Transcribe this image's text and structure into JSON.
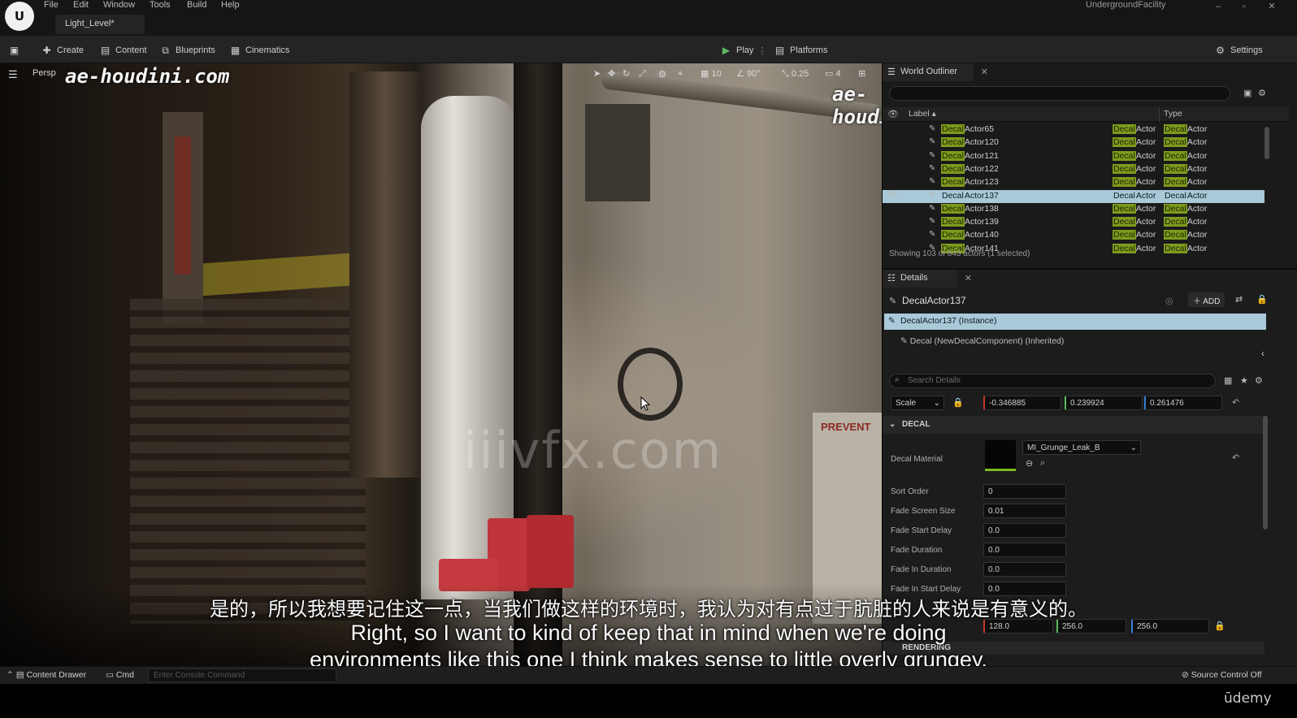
{
  "titlebar": {
    "logo": "U",
    "menus": [
      "File",
      "Edit",
      "Window",
      "Tools",
      "Build",
      "Help"
    ],
    "level_tab": "Light_Level*",
    "project": "UndergroundFacility",
    "win_min": "–",
    "win_max": "▫",
    "win_close": "✕"
  },
  "toolbar": {
    "create": "Create",
    "content": "Content",
    "blueprints": "Blueprints",
    "cinematics": "Cinematics",
    "play": "Play",
    "platforms": "Platforms",
    "settings": "Settings"
  },
  "viewport": {
    "perspective": "Persp",
    "grid": "10",
    "angle": "90°",
    "scale": "0.25",
    "camera": "4",
    "watermark_left": "ae-houdini.com",
    "watermark_right": "ae-houdini.com",
    "center_watermark": "iiivfx.com",
    "sign_text": "PREVENT"
  },
  "subtitles": {
    "cn": "是的，所以我想要记住这一点，当我们做这样的环境时，我认为对有点过于肮脏的人来说是有意义的。",
    "en1": "Right, so I want to kind of keep that in mind when we're doing",
    "en2": "environments like this one I think makes sense to little overly grungey."
  },
  "outliner": {
    "tab": "World Outliner",
    "col_label": "Label",
    "col_type": "Type",
    "rows": [
      {
        "label_hl": "Decal",
        "label": "Actor65",
        "t1": "Decal",
        "t1b": "Actor",
        "t2": "Decal",
        "t2b": "Actor"
      },
      {
        "label_hl": "Decal",
        "label": "Actor120",
        "t1": "Decal",
        "t1b": "Actor",
        "t2": "Decal",
        "t2b": "Actor"
      },
      {
        "label_hl": "Decal",
        "label": "Actor121",
        "t1": "Decal",
        "t1b": "Actor",
        "t2": "Decal",
        "t2b": "Actor"
      },
      {
        "label_hl": "Decal",
        "label": "Actor122",
        "t1": "Decal",
        "t1b": "Actor",
        "t2": "Decal",
        "t2b": "Actor"
      },
      {
        "label_hl": "Decal",
        "label": "Actor123",
        "t1": "Decal",
        "t1b": "Actor",
        "t2": "Decal",
        "t2b": "Actor"
      },
      {
        "label_hl": "Decal",
        "label": "Actor137",
        "t1": "Decal",
        "t1b": "Actor",
        "t2": "Decal",
        "t2b": "Actor"
      },
      {
        "label_hl": "Decal",
        "label": "Actor138",
        "t1": "Decal",
        "t1b": "Actor",
        "t2": "Decal",
        "t2b": "Actor"
      },
      {
        "label_hl": "Decal",
        "label": "Actor139",
        "t1": "Decal",
        "t1b": "Actor",
        "t2": "Decal",
        "t2b": "Actor"
      },
      {
        "label_hl": "Decal",
        "label": "Actor140",
        "t1": "Decal",
        "t1b": "Actor",
        "t2": "Decal",
        "t2b": "Actor"
      },
      {
        "label_hl": "Decal",
        "label": "Actor141",
        "t1": "Decal",
        "t1b": "Actor",
        "t2": "Decal",
        "t2b": "Actor"
      }
    ],
    "status": "Showing 103 of 843 actors (1 selected)"
  },
  "details": {
    "tab": "Details",
    "actor": "DecalActor137",
    "add": "ADD",
    "instance": "DecalActor137 (Instance)",
    "component": "Decal (NewDecalComponent) (Inherited)",
    "search_placeholder": "Search Details",
    "scale_label": "Scale",
    "scale_x": "-0.346885",
    "scale_y": "0.239924",
    "scale_z": "0.261476",
    "section_decal": "DECAL",
    "decal_material_label": "Decal Material",
    "decal_material": "MI_Grunge_Leak_B",
    "sort_order_label": "Sort Order",
    "sort_order": "0",
    "fade_screen_label": "Fade Screen Size",
    "fade_screen": "0.01",
    "fade_start_label": "Fade Start Delay",
    "fade_start": "0.0",
    "fade_duration_label": "Fade Duration",
    "fade_duration": "0.0",
    "fade_in_duration_label": "Fade In Duration",
    "fade_in_duration": "0.0",
    "fade_in_start_label": "Fade In Start Delay",
    "fade_in_start": "0.0",
    "size_x": "128.0",
    "size_y": "256.0",
    "size_z": "256.0",
    "section_rendering": "RENDERING"
  },
  "statusbar": {
    "content_drawer": "Content Drawer",
    "cmd": "Cmd",
    "console_placeholder": "Enter Console Command",
    "source_control": "Source Control Off"
  },
  "branding": {
    "udemy": "ūdemy"
  }
}
